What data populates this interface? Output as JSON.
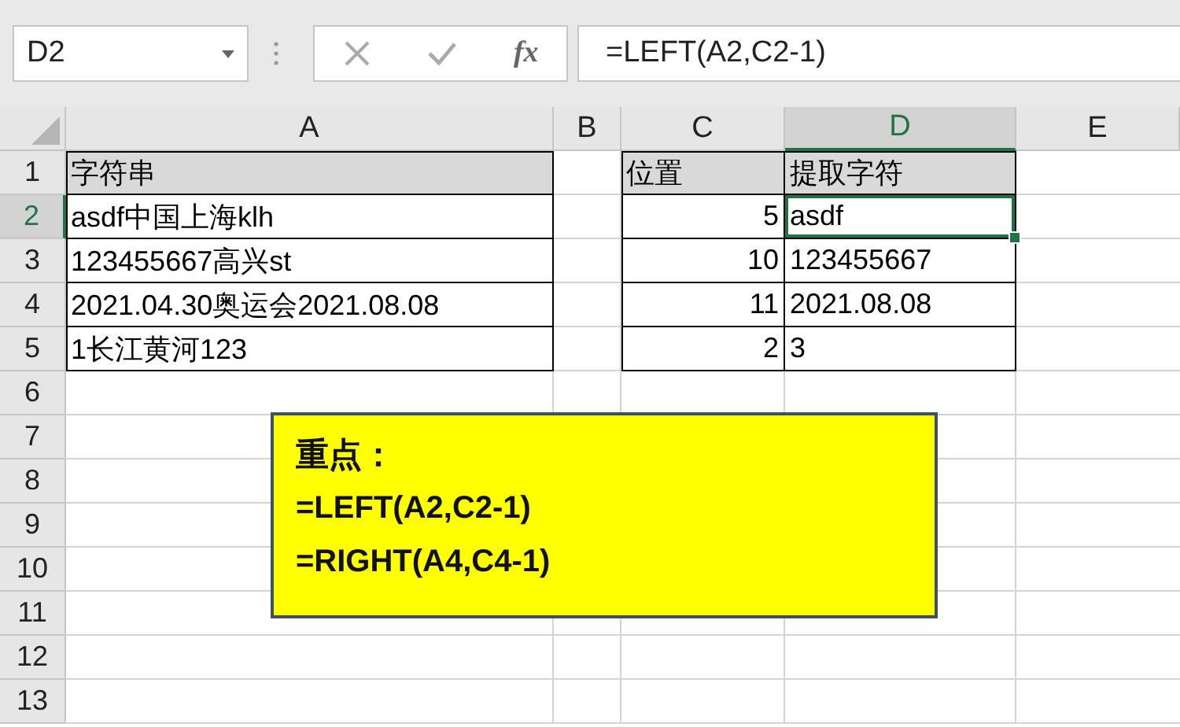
{
  "name_box": {
    "value": "D2"
  },
  "formula_bar": {
    "function_label": "fx",
    "value": "=LEFT(A2,C2-1)"
  },
  "columns": [
    {
      "label": "A",
      "selected": false
    },
    {
      "label": "B",
      "selected": false
    },
    {
      "label": "C",
      "selected": false
    },
    {
      "label": "D",
      "selected": true
    },
    {
      "label": "E",
      "selected": false
    }
  ],
  "rows": [
    {
      "number": "1",
      "selected": false,
      "kind": "header",
      "a": {
        "text": "字符串"
      },
      "c": {
        "text": "位置"
      },
      "d": {
        "text": "提取字符",
        "selected": false
      }
    },
    {
      "number": "2",
      "selected": true,
      "kind": "data",
      "a": {
        "text": "asdf中国上海klh"
      },
      "c": {
        "text": "5"
      },
      "d": {
        "text": "asdf",
        "selected": true
      }
    },
    {
      "number": "3",
      "selected": false,
      "kind": "data",
      "a": {
        "text": "123455667高兴st"
      },
      "c": {
        "text": "10"
      },
      "d": {
        "text": "123455667",
        "selected": false
      }
    },
    {
      "number": "4",
      "selected": false,
      "kind": "data",
      "a": {
        "text": "2021.04.30奥运会2021.08.08"
      },
      "c": {
        "text": "11"
      },
      "d": {
        "text": "2021.08.08",
        "selected": false
      }
    },
    {
      "number": "5",
      "selected": false,
      "kind": "data",
      "a": {
        "text": "1长江黄河123"
      },
      "c": {
        "text": "2"
      },
      "d": {
        "text": "3",
        "selected": false
      }
    },
    {
      "number": "6",
      "selected": false,
      "kind": "empty"
    },
    {
      "number": "7",
      "selected": false,
      "kind": "empty"
    },
    {
      "number": "8",
      "selected": false,
      "kind": "empty"
    },
    {
      "number": "9",
      "selected": false,
      "kind": "empty"
    },
    {
      "number": "10",
      "selected": false,
      "kind": "empty"
    },
    {
      "number": "11",
      "selected": false,
      "kind": "empty"
    },
    {
      "number": "12",
      "selected": false,
      "kind": "empty"
    },
    {
      "number": "13",
      "selected": false,
      "kind": "empty"
    }
  ],
  "note_box": {
    "title": "重点：",
    "lines": [
      "=LEFT(A2,C2-1)",
      "=RIGHT(A4,C4-1)"
    ]
  }
}
